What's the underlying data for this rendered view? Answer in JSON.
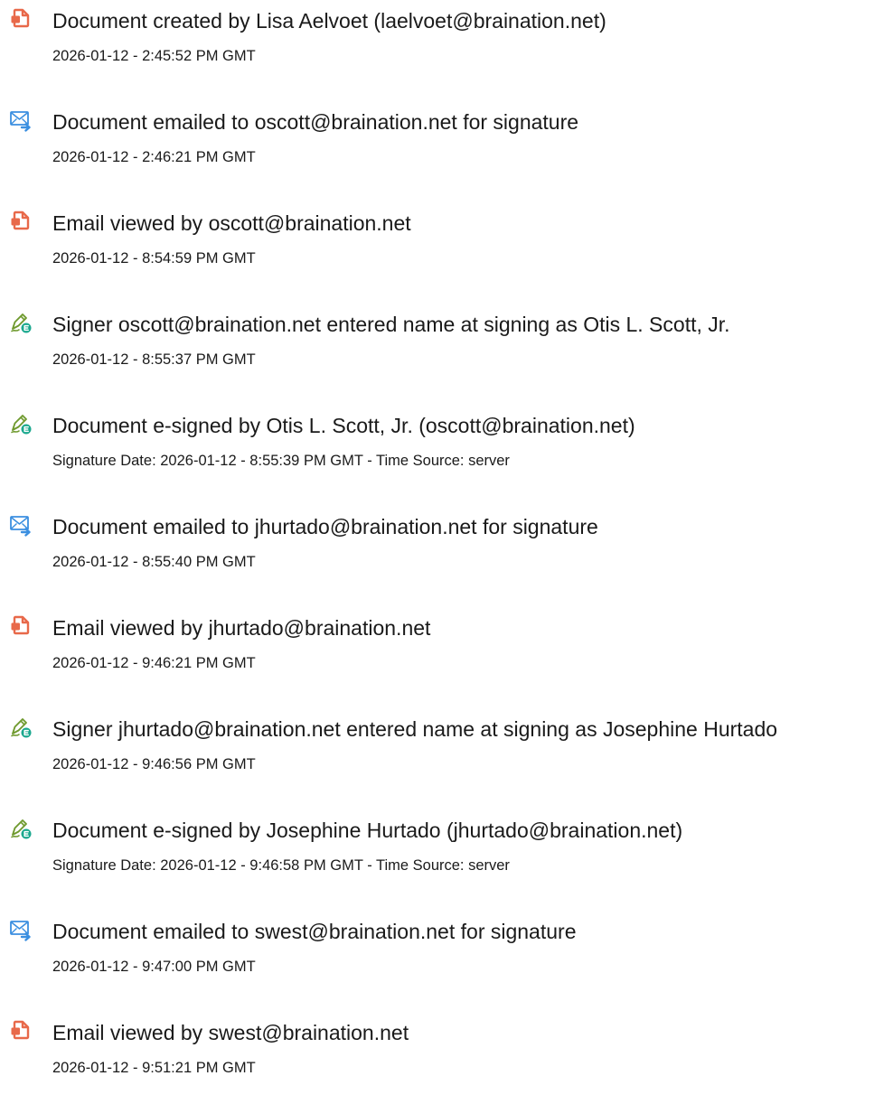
{
  "colors": {
    "document_icon": "#e8694a",
    "email_icon": "#3b8fe0",
    "sign_icon_pen": "#6f9a2e",
    "sign_icon_badge": "#1aa88e",
    "text": "#1a1a1a"
  },
  "events": [
    {
      "icon": "document-icon",
      "title": "Document created by Lisa Aelvoet (laelvoet@braination.net)",
      "time": "2026-01-12 - 2:45:52 PM GMT"
    },
    {
      "icon": "email-sent-icon",
      "title": "Document emailed to oscott@braination.net for signature",
      "time": "2026-01-12 - 2:46:21 PM GMT"
    },
    {
      "icon": "document-icon",
      "title": "Email viewed by oscott@braination.net",
      "time": "2026-01-12 - 8:54:59 PM GMT"
    },
    {
      "icon": "esign-pen-icon",
      "title": "Signer oscott@braination.net entered name at signing as Otis L. Scott, Jr.",
      "time": "2026-01-12 - 8:55:37 PM GMT"
    },
    {
      "icon": "esign-pen-icon",
      "title": "Document e-signed by Otis L. Scott, Jr. (oscott@braination.net)",
      "time": "Signature Date: 2026-01-12 - 8:55:39 PM GMT - Time Source: server"
    },
    {
      "icon": "email-sent-icon",
      "title": "Document emailed to jhurtado@braination.net for signature",
      "time": "2026-01-12 - 8:55:40 PM GMT"
    },
    {
      "icon": "document-icon",
      "title": "Email viewed by jhurtado@braination.net",
      "time": "2026-01-12 - 9:46:21 PM GMT"
    },
    {
      "icon": "esign-pen-icon",
      "title": "Signer jhurtado@braination.net entered name at signing as Josephine Hurtado",
      "time": "2026-01-12 - 9:46:56 PM GMT"
    },
    {
      "icon": "esign-pen-icon",
      "title": "Document e-signed by Josephine Hurtado (jhurtado@braination.net)",
      "time": "Signature Date: 2026-01-12 - 9:46:58 PM GMT - Time Source: server"
    },
    {
      "icon": "email-sent-icon",
      "title": "Document emailed to swest@braination.net for signature",
      "time": "2026-01-12 - 9:47:00 PM GMT"
    },
    {
      "icon": "document-icon",
      "title": "Email viewed by swest@braination.net",
      "time": "2026-01-12 - 9:51:21 PM GMT"
    }
  ]
}
